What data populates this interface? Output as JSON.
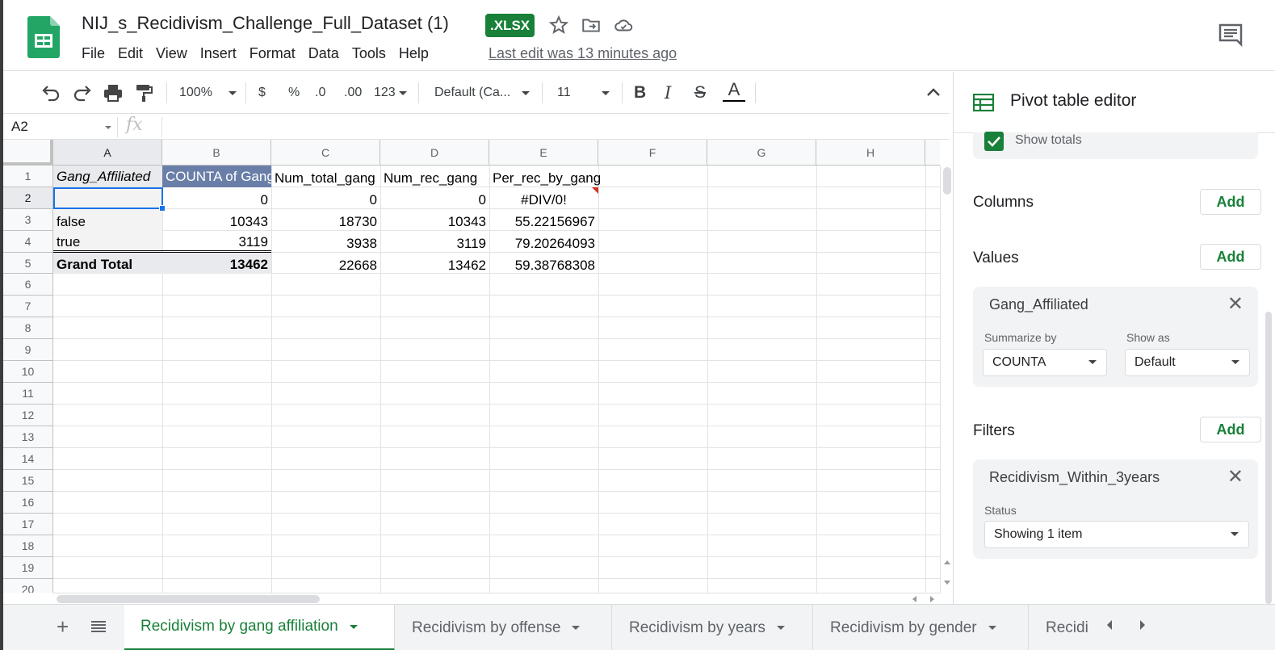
{
  "doc": {
    "title": "NIJ_s_Recidivism_Challenge_Full_Dataset (1)",
    "badge": ".XLSX",
    "last_edit": "Last edit was 13 minutes ago"
  },
  "menu": [
    "File",
    "Edit",
    "View",
    "Insert",
    "Format",
    "Data",
    "Tools",
    "Help"
  ],
  "toolbar": {
    "zoom": "100%",
    "currency": "$",
    "percent": "%",
    "dec_less": ".0",
    "dec_more": ".00",
    "more_formats": "123",
    "font": "Default (Ca...",
    "font_size": "11",
    "bold": "B",
    "italic": "I",
    "strike": "S",
    "text_color": "A"
  },
  "formula_bar": {
    "name_box": "A2",
    "fx": "fx",
    "value": ""
  },
  "columns": [
    "A",
    "B",
    "C",
    "D",
    "E",
    "F",
    "G",
    "H"
  ],
  "rows": [
    "1",
    "2",
    "3",
    "4",
    "5",
    "6",
    "7",
    "8",
    "9",
    "10",
    "11",
    "12",
    "13",
    "14",
    "15",
    "16",
    "17",
    "18",
    "19",
    "20"
  ],
  "cells": {
    "A1": "Gang_Affiliated",
    "B1": "COUNTA of Gang_Affiliated",
    "C1": "Num_total_gang",
    "D1": "Num_rec_gang",
    "E1": "Per_rec_by_gang",
    "A2": "",
    "B2": "0",
    "C2": "0",
    "D2": "0",
    "E2": "#DIV/0!",
    "A3": "false",
    "B3": "10343",
    "C3": "18730",
    "D3": "10343",
    "E3": "55.22156967",
    "A4": "true",
    "B4": "3119",
    "C4": "3938",
    "D4": "3119",
    "E4": "79.20264093",
    "A5": "Grand Total",
    "B5": "13462",
    "C5": "22668",
    "D5": "13462",
    "E5": "59.38768308"
  },
  "sheet_tabs": [
    "Recidivism by gang affiliation",
    "Recidivism by offense",
    "Recidivism by years",
    "Recidivism by gender",
    "Recidi"
  ],
  "panel": {
    "title": "Pivot table editor",
    "show_totals": "Show totals",
    "columns_label": "Columns",
    "values_label": "Values",
    "filters_label": "Filters",
    "add": "Add",
    "value_card": {
      "title": "Gang_Affiliated",
      "summarize_label": "Summarize by",
      "summarize_value": "COUNTA",
      "show_as_label": "Show as",
      "show_as_value": "Default"
    },
    "filter_card": {
      "title": "Recidivism_Within_3years",
      "status_label": "Status",
      "status_value": "Showing 1 item"
    }
  },
  "colors": {
    "brand_green": "#188038",
    "header_blue": "#6a7fa8",
    "selection_blue": "#1a73e8"
  }
}
